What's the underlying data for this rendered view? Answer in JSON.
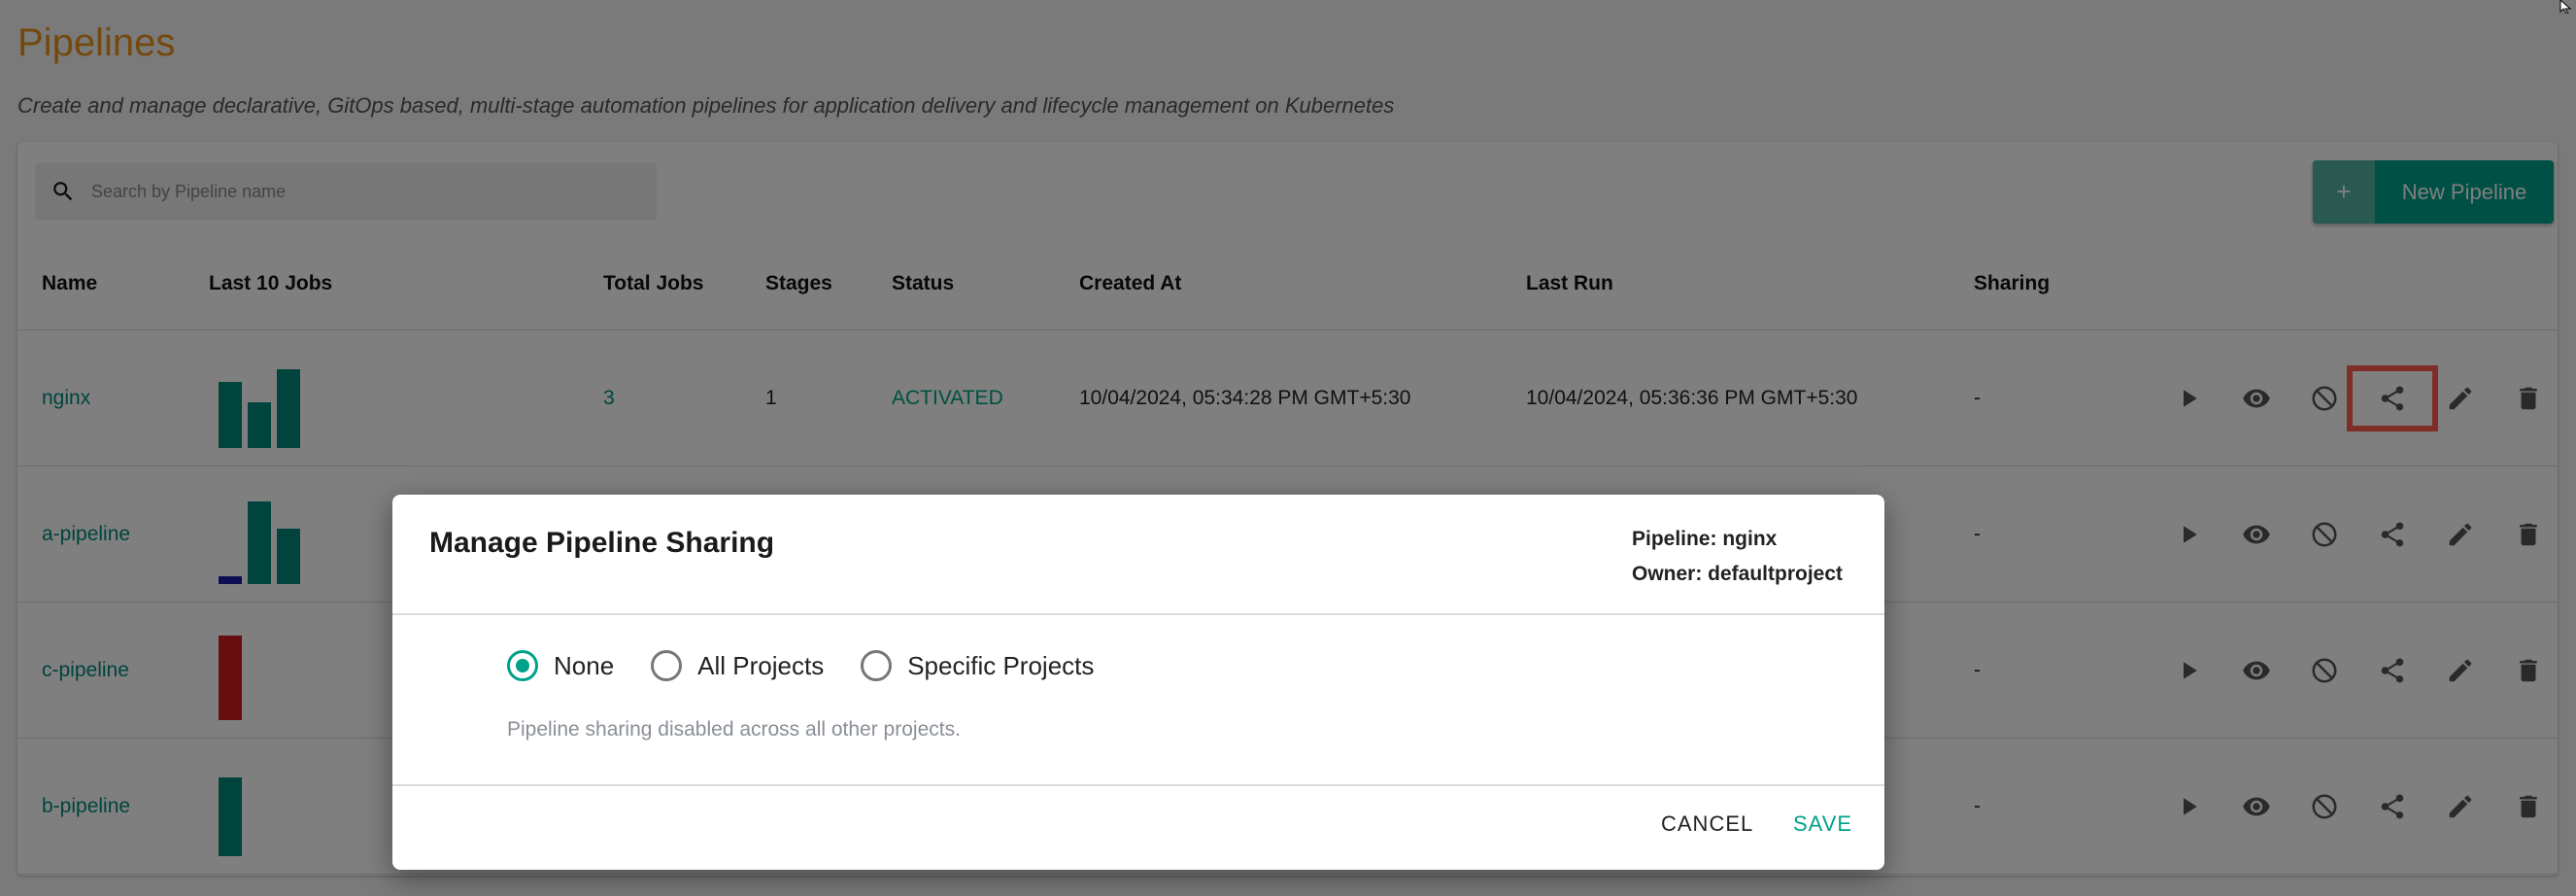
{
  "page": {
    "title": "Pipelines",
    "subtitle": "Create and manage declarative, GitOps based, multi-stage automation pipelines for application delivery and lifecycle management on Kubernetes"
  },
  "search": {
    "placeholder": "Search by Pipeline name",
    "value": ""
  },
  "new_button": {
    "icon": "+",
    "label": "New Pipeline"
  },
  "colors": {
    "accent": "#00a18a",
    "title": "#e8921c",
    "bar_success": "#00897b",
    "bar_failed": "#d11a1a",
    "bar_running": "#1a1aa8",
    "highlight": "#ff5a4e"
  },
  "table": {
    "headers": [
      "Name",
      "Last 10 Jobs",
      "Total Jobs",
      "Stages",
      "Status",
      "Created At",
      "Last Run",
      "Sharing"
    ],
    "rows": [
      {
        "name": "nginx",
        "jobs": [
          {
            "status": "success",
            "value": 0.65
          },
          {
            "status": "success",
            "value": 0.45
          },
          {
            "status": "success",
            "value": 0.78
          }
        ],
        "total_jobs": "3",
        "stages": "1",
        "status": "ACTIVATED",
        "created_at": "10/04/2024, 05:34:28 PM GMT+5:30",
        "last_run": "10/04/2024, 05:36:36 PM GMT+5:30",
        "sharing": "-"
      },
      {
        "name": "a-pipeline",
        "jobs": [
          {
            "status": "running",
            "value": 0.08
          },
          {
            "status": "success",
            "value": 0.82
          },
          {
            "status": "success",
            "value": 0.55
          }
        ],
        "sharing": "-"
      },
      {
        "name": "c-pipeline",
        "jobs": [
          {
            "status": "failed",
            "value": 0.84
          }
        ],
        "sharing": "-"
      },
      {
        "name": "b-pipeline",
        "jobs": [
          {
            "status": "success",
            "value": 0.78
          }
        ],
        "sharing": "-"
      }
    ],
    "actions": [
      "play-icon",
      "eye-icon",
      "disable-icon",
      "share-icon",
      "edit-icon",
      "delete-icon"
    ]
  },
  "modal": {
    "title": "Manage Pipeline Sharing",
    "pipeline_label": "Pipeline: nginx",
    "owner_label": "Owner: defaultproject",
    "options": [
      {
        "label": "None",
        "checked": true
      },
      {
        "label": "All Projects",
        "checked": false
      },
      {
        "label": "Specific Projects",
        "checked": false
      }
    ],
    "helper_text": "Pipeline sharing disabled across all other projects.",
    "cancel_label": "CANCEL",
    "save_label": "SAVE"
  }
}
